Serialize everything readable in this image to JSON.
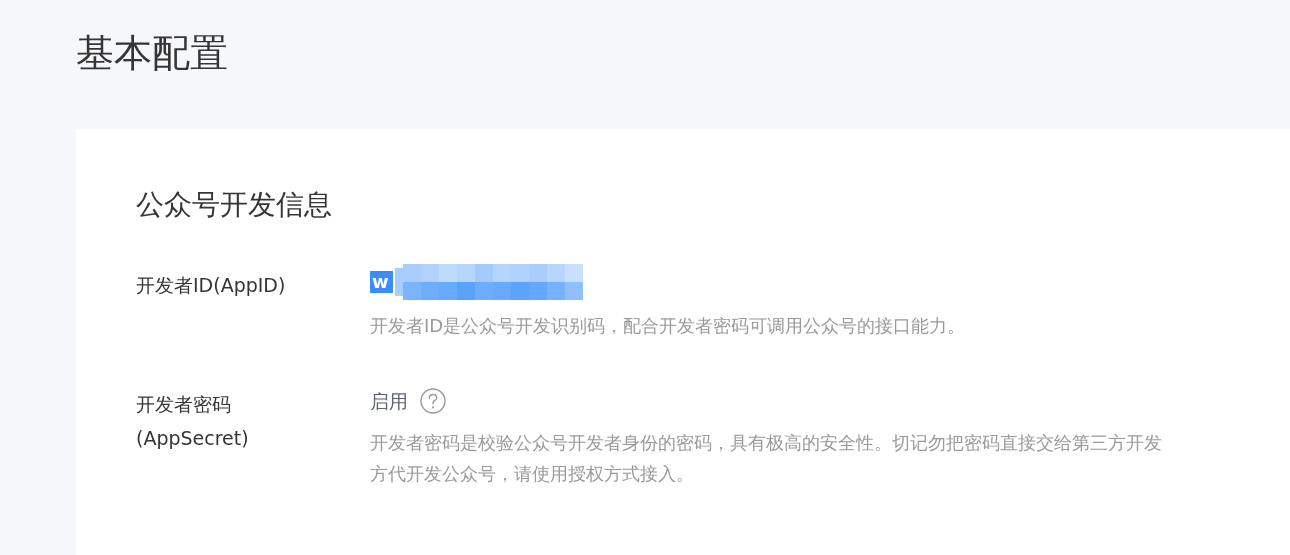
{
  "page_title": "基本配置",
  "card": {
    "title": "公众号开发信息",
    "rows": [
      {
        "kind": "appid",
        "label_lines": [
          "开发者ID(AppID)"
        ],
        "value": "w",
        "value_selected": true,
        "redacted": true,
        "description_lines": [
          "开发者ID是公众号开发识别码，配合开发者密码可调用公众号的接口能力。"
        ]
      },
      {
        "kind": "secret",
        "label_lines": [
          "开发者密码",
          "(AppSecret)"
        ],
        "value": "启用",
        "help": true,
        "description_lines": [
          "开发者密码是校验公众号开发者身份的密码，具有极高的安全性。切记勿把密码直接交给第三方开发",
          "方代开发公众号，请使用授权方式接入。"
        ]
      }
    ]
  }
}
